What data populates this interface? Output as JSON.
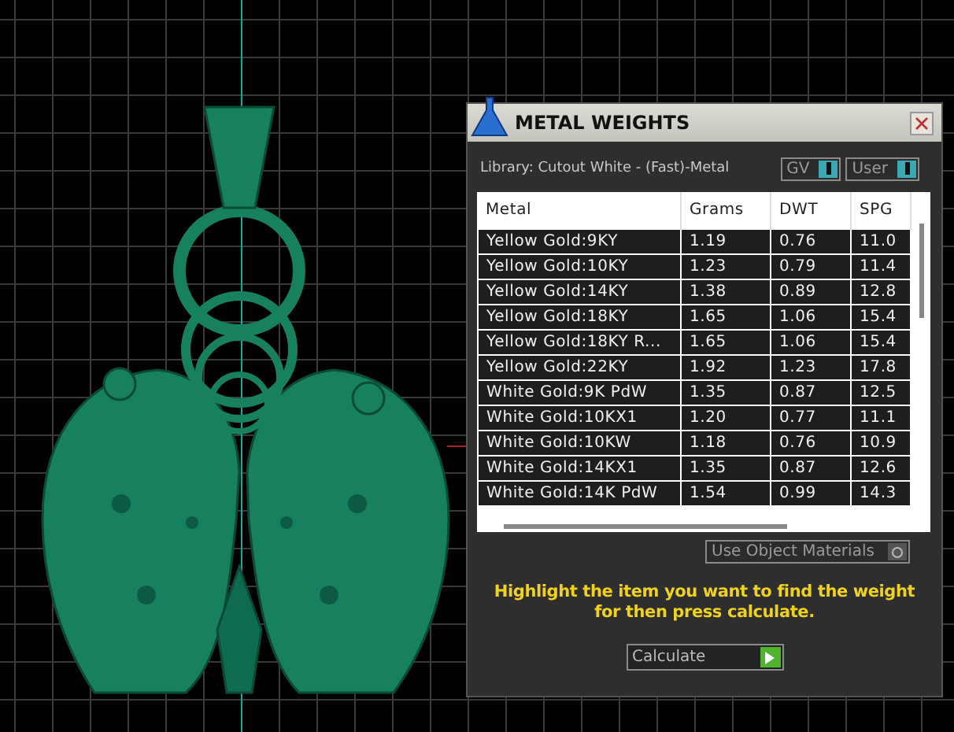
{
  "dialog": {
    "title": "METAL WEIGHTS",
    "library": "Library: Cutout White - (Fast)-Metal",
    "toggles": [
      {
        "label": "GV",
        "on": true
      },
      {
        "label": "User",
        "on": true
      }
    ],
    "table": {
      "columns": [
        "Metal",
        "Grams",
        "DWT",
        "SPG"
      ],
      "rows": [
        [
          "Yellow Gold:9KY",
          "1.19",
          "0.76",
          "11.0"
        ],
        [
          "Yellow Gold:10KY",
          "1.23",
          "0.79",
          "11.4"
        ],
        [
          "Yellow Gold:14KY",
          "1.38",
          "0.89",
          "12.8"
        ],
        [
          "Yellow Gold:18KY",
          "1.65",
          "1.06",
          "15.4"
        ],
        [
          "Yellow Gold:18KY R...",
          "1.65",
          "1.06",
          "15.4"
        ],
        [
          "Yellow Gold:22KY",
          "1.92",
          "1.23",
          "17.8"
        ],
        [
          "White Gold:9K PdW",
          "1.35",
          "0.87",
          "12.5"
        ],
        [
          "White Gold:10KX1",
          "1.20",
          "0.77",
          "11.1"
        ],
        [
          "White Gold:10KW",
          "1.18",
          "0.76",
          "10.9"
        ],
        [
          "White Gold:14KX1",
          "1.35",
          "0.87",
          "12.6"
        ],
        [
          "White Gold:14K PdW",
          "1.54",
          "0.99",
          "14.3"
        ]
      ]
    },
    "use_object_materials": {
      "label": "Use Object Materials",
      "on": false
    },
    "hint": "Highlight the item you want to find the weight for then press calculate.",
    "calculate_button": "Calculate"
  }
}
